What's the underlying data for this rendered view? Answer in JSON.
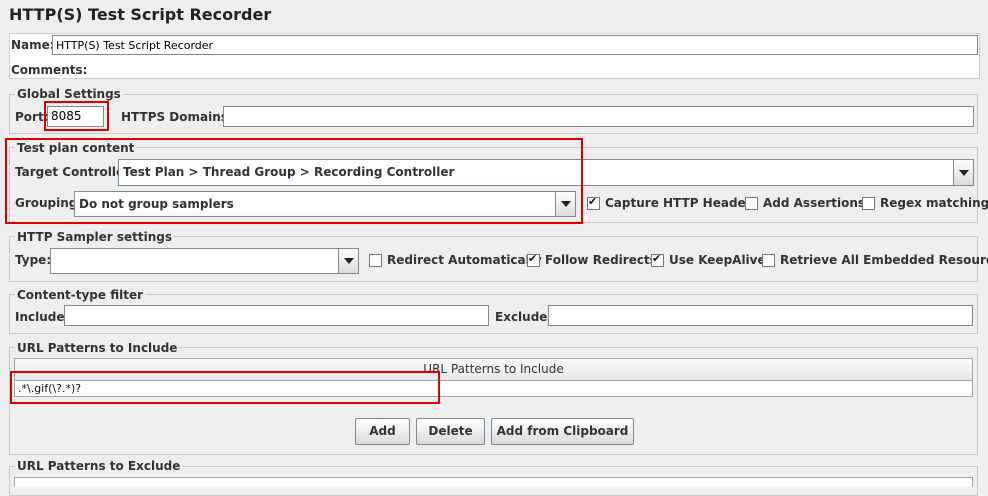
{
  "title": "HTTP(S) Test Script Recorder",
  "name": {
    "label": "Name:",
    "value": "HTTP(S) Test Script Recorder"
  },
  "comments": {
    "label": "Comments:",
    "value": ""
  },
  "global_settings": {
    "legend": "Global Settings",
    "port_label": "Port:",
    "port_value": "8085",
    "https_label": "HTTPS Domains :",
    "https_value": ""
  },
  "test_plan": {
    "legend": "Test plan content",
    "target_label": "Target Controller:",
    "target_value": "Test Plan > Thread Group > Recording Controller",
    "grouping_label": "Grouping:",
    "grouping_value": "Do not group samplers",
    "capture_headers": {
      "label": "Capture HTTP Headers",
      "checked": true
    },
    "add_assertions": {
      "label": "Add Assertions",
      "checked": false
    },
    "regex_matching": {
      "label": "Regex matching",
      "checked": false
    }
  },
  "sampler": {
    "legend": "HTTP Sampler settings",
    "type_label": "Type:",
    "type_value": "",
    "redirect_auto": {
      "label": "Redirect Automatically",
      "checked": false
    },
    "follow_redirects": {
      "label": "Follow Redirects",
      "checked": true
    },
    "keepalive": {
      "label": "Use KeepAlive",
      "checked": true
    },
    "embedded": {
      "label": "Retrieve All Embedded Resources",
      "checked": false
    }
  },
  "content_filter": {
    "legend": "Content-type filter",
    "include_label": "Include:",
    "include_value": "",
    "exclude_label": "Exclude:",
    "exclude_value": ""
  },
  "include_patterns": {
    "legend": "URL Patterns to Include",
    "column_header": "URL Patterns to Include",
    "rows": [
      ".*\\.gif(\\?.*)?"
    ],
    "buttons": {
      "add": "Add",
      "delete": "Delete",
      "clipboard": "Add from Clipboard"
    }
  },
  "exclude_patterns": {
    "legend": "URL Patterns to Exclude"
  },
  "colors": {
    "highlight": "#e00000",
    "background": "#eeeeee"
  }
}
